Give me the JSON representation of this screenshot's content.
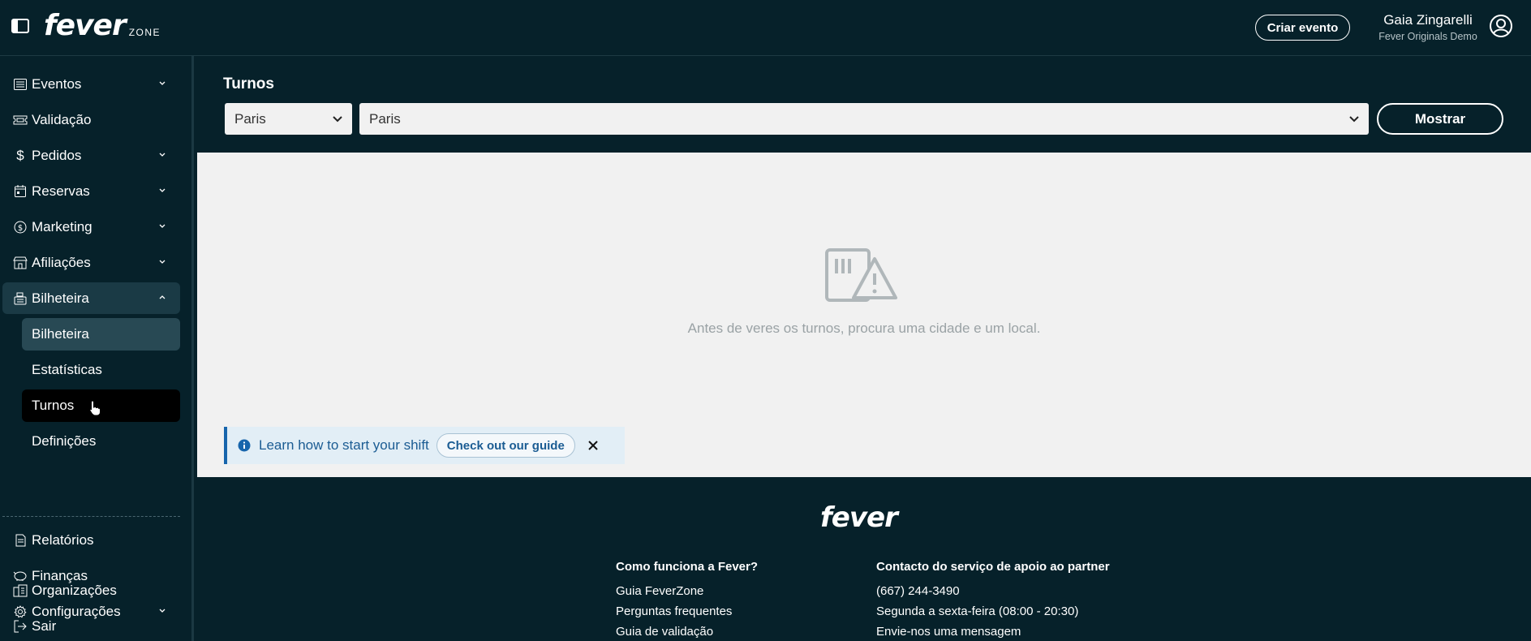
{
  "header": {
    "brand": "fever",
    "brand_suffix": "ZONE",
    "create_event": "Criar evento",
    "user_name": "Gaia Zingarelli",
    "user_org": "Fever Originals Demo"
  },
  "sidebar": {
    "items": [
      {
        "label": "Eventos",
        "icon": "list-icon"
      },
      {
        "label": "Validação",
        "icon": "ticket-icon"
      },
      {
        "label": "Pedidos",
        "icon": "dollar-icon"
      },
      {
        "label": "Reservas",
        "icon": "calendar-icon"
      },
      {
        "label": "Marketing",
        "icon": "coin-icon"
      },
      {
        "label": "Afiliações",
        "icon": "store-icon"
      },
      {
        "label": "Bilheteira",
        "icon": "cash-register-icon"
      },
      {
        "label": "Relatórios",
        "icon": "document-icon"
      },
      {
        "label": "Finanças",
        "icon": "piggy-bank-icon"
      },
      {
        "label": "Configurações",
        "icon": "gear-icon"
      },
      {
        "label": "Organizações",
        "icon": "buildings-icon"
      },
      {
        "label": "Sair",
        "icon": "logout-icon"
      }
    ],
    "subitems": [
      {
        "label": "Bilheteira"
      },
      {
        "label": "Estatísticas"
      },
      {
        "label": "Turnos"
      },
      {
        "label": "Definições"
      }
    ]
  },
  "main": {
    "title": "Turnos",
    "city_select": "Paris",
    "venue_select": "Paris",
    "show_button": "Mostrar",
    "empty_text": "Antes de veres os turnos, procura uma cidade e um local.",
    "banner_text": "Learn how to start your shift",
    "banner_button": "Check out our guide"
  },
  "footer": {
    "logo": "fever",
    "col1": {
      "heading": "Como funciona a Fever?",
      "links": [
        "Guia FeverZone",
        "Perguntas frequentes",
        "Guia de validação"
      ]
    },
    "col2": {
      "heading": "Contacto do serviço de apoio ao partner",
      "lines": [
        "(667) 244-3490",
        "Segunda a sexta-feira (08:00 - 20:30)",
        "Envie-nos uma mensagem"
      ]
    }
  },
  "colors": {
    "background": "#06212a",
    "content_bg": "#f1f1f1",
    "active_nav": "#284954",
    "banner_bg": "#e2eef6",
    "banner_accent": "#1765ac"
  }
}
